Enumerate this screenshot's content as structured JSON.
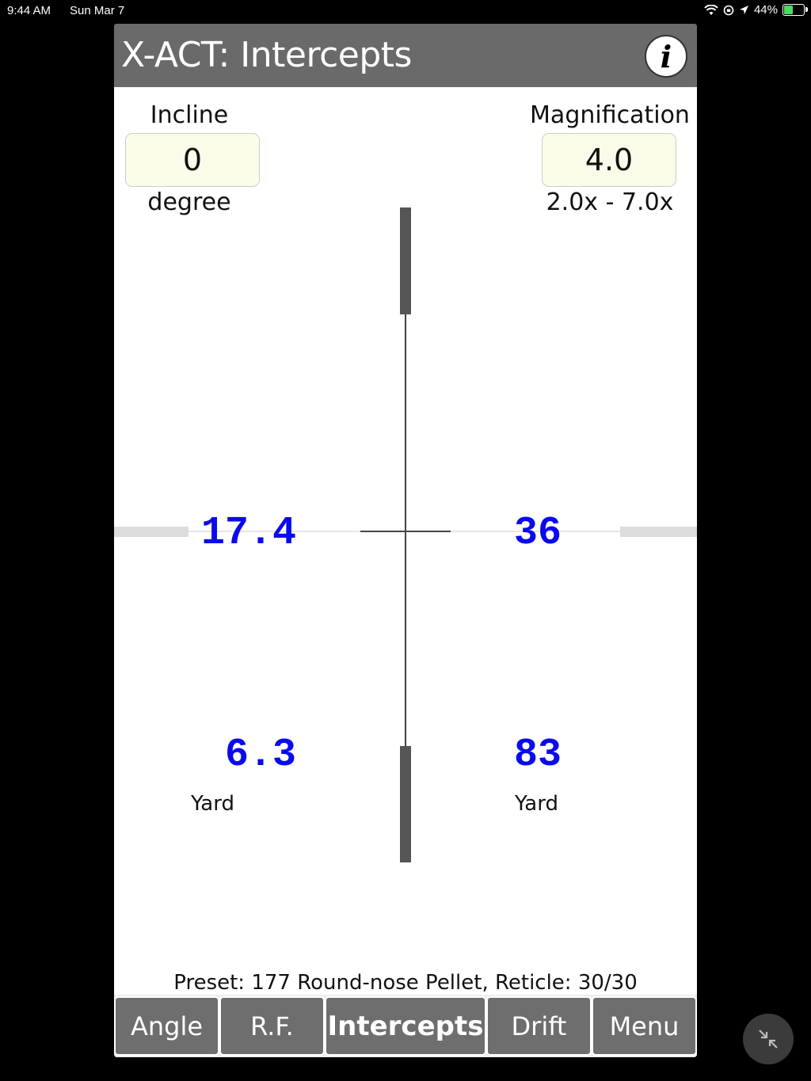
{
  "status_bar": {
    "time": "9:44 AM",
    "date": "Sun Mar 7",
    "battery": "44%",
    "battery_level": 0.44,
    "icons": [
      "wifi-icon",
      "orientation-lock-icon",
      "location-icon",
      "battery-charging-icon"
    ]
  },
  "header": {
    "title": "X-ACT: Intercepts",
    "info_label": "i"
  },
  "incline": {
    "label": "Incline",
    "value": "0",
    "unit": "degree"
  },
  "magnification": {
    "label": "Magnification",
    "value": "4.0",
    "range": "2.0x - 7.0x"
  },
  "reticle": {
    "left_upper": "17.4",
    "right_upper": "36",
    "left_lower": "6.3",
    "right_lower": "83",
    "left_unit": "Yard",
    "right_unit": "Yard"
  },
  "preset_text": "Preset: 177 Round-nose Pellet, Reticle: 30/30",
  "tabs": [
    {
      "label": "Angle",
      "active": false
    },
    {
      "label": "R.F.",
      "active": false
    },
    {
      "label": "Intercepts",
      "active": true
    },
    {
      "label": "Drift",
      "active": false
    },
    {
      "label": "Menu",
      "active": false
    }
  ],
  "colors": {
    "title_bar": "#6a6a6a",
    "value_text": "#0a0aee",
    "field_bg": "#fbfbe9"
  }
}
